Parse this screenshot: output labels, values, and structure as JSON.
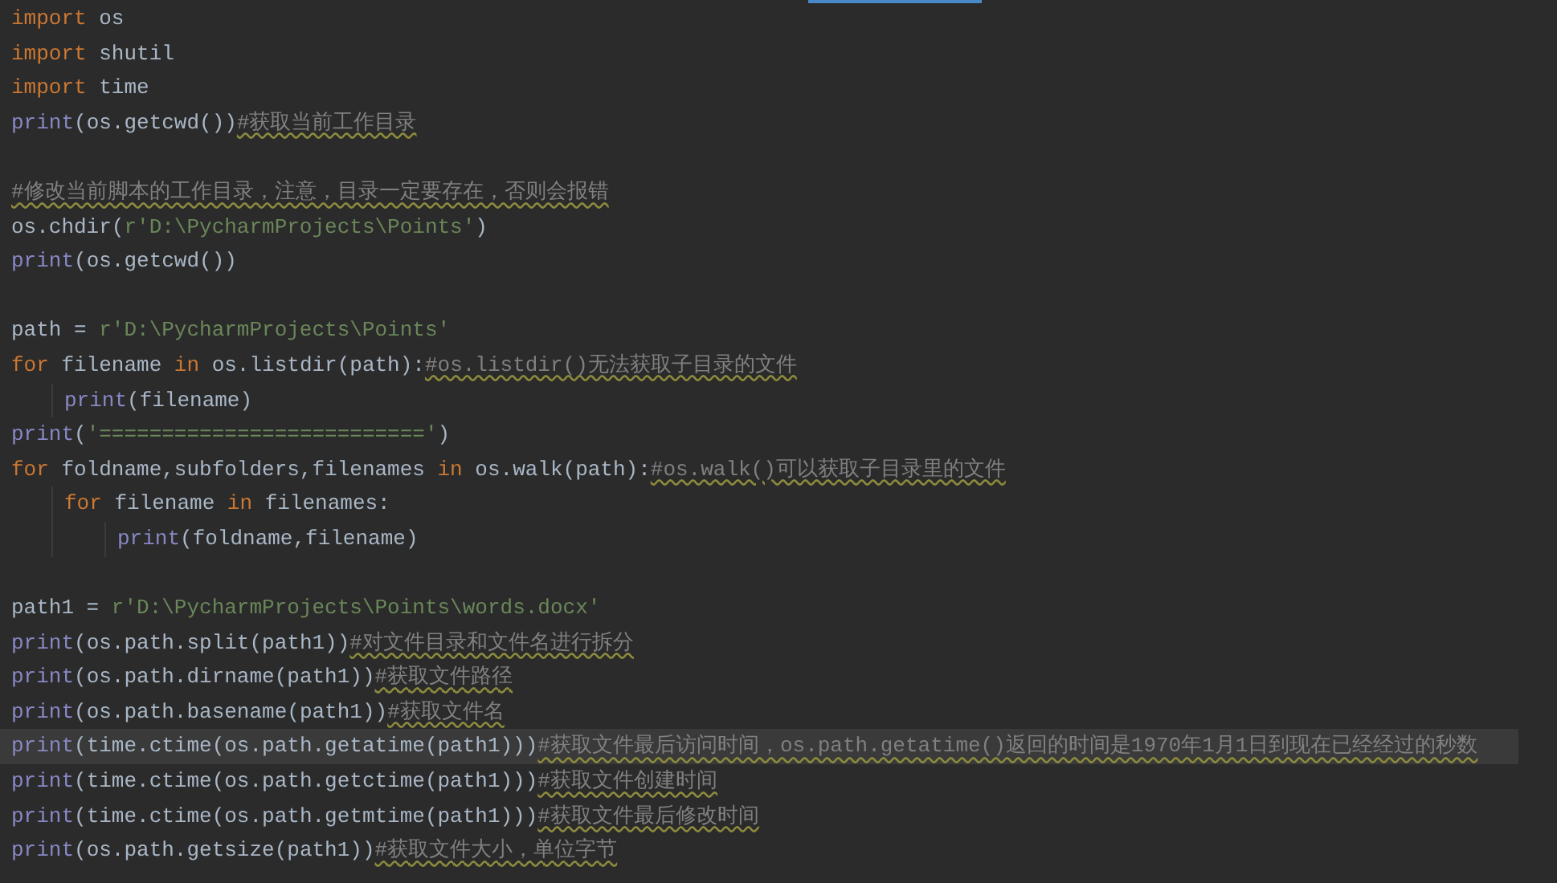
{
  "editor": {
    "lines": [
      {
        "current": false,
        "tokens": [
          {
            "kind": "keyword",
            "text": "import"
          },
          {
            "kind": "plain",
            "text": " os"
          }
        ]
      },
      {
        "current": false,
        "tokens": [
          {
            "kind": "keyword",
            "text": "import"
          },
          {
            "kind": "plain",
            "text": " shutil"
          }
        ]
      },
      {
        "current": false,
        "tokens": [
          {
            "kind": "keyword",
            "text": "import"
          },
          {
            "kind": "plain",
            "text": " time"
          }
        ]
      },
      {
        "current": false,
        "tokens": [
          {
            "kind": "builtin",
            "text": "print"
          },
          {
            "kind": "plain",
            "text": "(os.getcwd())"
          },
          {
            "kind": "comment",
            "text": "#获取当前工作目录"
          }
        ]
      },
      {
        "current": false
      },
      {
        "current": false,
        "tokens": [
          {
            "kind": "comment",
            "text": "#修改当前脚本的工作目录，注意，目录一定要存在，否则会报错"
          }
        ]
      },
      {
        "current": false,
        "tokens": [
          {
            "kind": "plain",
            "text": "os.chdir("
          },
          {
            "kind": "string",
            "text": "r'D:\\PycharmProjects\\Points'"
          },
          {
            "kind": "plain",
            "text": ")"
          }
        ]
      },
      {
        "current": false,
        "tokens": [
          {
            "kind": "builtin",
            "text": "print"
          },
          {
            "kind": "plain",
            "text": "(os.getcwd())"
          }
        ]
      },
      {
        "current": false
      },
      {
        "current": false,
        "tokens": [
          {
            "kind": "plain",
            "text": "path = "
          },
          {
            "kind": "string",
            "text": "r'D:\\PycharmProjects\\Points'"
          }
        ]
      },
      {
        "current": false,
        "tokens": [
          {
            "kind": "keyword",
            "text": "for"
          },
          {
            "kind": "plain",
            "text": " filename "
          },
          {
            "kind": "keyword",
            "text": "in"
          },
          {
            "kind": "plain",
            "text": " os.listdir(path):"
          },
          {
            "kind": "comment",
            "text": "#os.listdir()无法获取子目录的文件"
          }
        ],
        "children": [
          {
            "current": false,
            "tokens": [
              {
                "kind": "builtin",
                "text": "print"
              },
              {
                "kind": "plain",
                "text": "(filename)"
              }
            ]
          }
        ]
      },
      {
        "current": false,
        "tokens": [
          {
            "kind": "builtin",
            "text": "print"
          },
          {
            "kind": "plain",
            "text": "("
          },
          {
            "kind": "string",
            "text": "'=========================='"
          },
          {
            "kind": "plain",
            "text": ")"
          }
        ]
      },
      {
        "current": false,
        "tokens": [
          {
            "kind": "keyword",
            "text": "for"
          },
          {
            "kind": "plain",
            "text": " foldname,subfolders,filenames "
          },
          {
            "kind": "keyword",
            "text": "in"
          },
          {
            "kind": "plain",
            "text": " os.walk(path):"
          },
          {
            "kind": "comment",
            "text": "#os.walk()可以获取子目录里的文件"
          }
        ],
        "children": [
          {
            "current": false,
            "tokens": [
              {
                "kind": "keyword",
                "text": "for"
              },
              {
                "kind": "plain",
                "text": " filename "
              },
              {
                "kind": "keyword",
                "text": "in"
              },
              {
                "kind": "plain",
                "text": " filenames:"
              }
            ],
            "children": [
              {
                "current": false,
                "tokens": [
                  {
                    "kind": "builtin",
                    "text": "print"
                  },
                  {
                    "kind": "plain",
                    "text": "(foldname,filename)"
                  }
                ]
              }
            ]
          }
        ]
      },
      {
        "current": false
      },
      {
        "current": false,
        "tokens": [
          {
            "kind": "plain",
            "text": "path1 = "
          },
          {
            "kind": "string",
            "text": "r'D:\\PycharmProjects\\Points\\words.docx'"
          }
        ]
      },
      {
        "current": false,
        "tokens": [
          {
            "kind": "builtin",
            "text": "print"
          },
          {
            "kind": "plain",
            "text": "(os.path.split(path1))"
          },
          {
            "kind": "comment",
            "text": "#对文件目录和文件名进行拆分"
          }
        ]
      },
      {
        "current": false,
        "tokens": [
          {
            "kind": "builtin",
            "text": "print"
          },
          {
            "kind": "plain",
            "text": "(os.path.dirname(path1))"
          },
          {
            "kind": "comment",
            "text": "#获取文件路径"
          }
        ]
      },
      {
        "current": false,
        "tokens": [
          {
            "kind": "builtin",
            "text": "print"
          },
          {
            "kind": "plain",
            "text": "(os.path.basename(path1))"
          },
          {
            "kind": "comment",
            "text": "#获取文件名"
          }
        ]
      },
      {
        "current": true,
        "tokens": [
          {
            "kind": "builtin",
            "text": "print"
          },
          {
            "kind": "plain",
            "text": "(time.ctime(os.path.getatime(path1)))"
          },
          {
            "kind": "comment",
            "text": "#获取文件最后访问时间，os.path.getatime()返回的时间是1970年1月1日到现在已经经过的秒数"
          }
        ]
      },
      {
        "current": false,
        "tokens": [
          {
            "kind": "builtin",
            "text": "print"
          },
          {
            "kind": "plain",
            "text": "(time.ctime(os.path.getctime(path1)))"
          },
          {
            "kind": "comment",
            "text": "#获取文件创建时间"
          }
        ]
      },
      {
        "current": false,
        "tokens": [
          {
            "kind": "builtin",
            "text": "print"
          },
          {
            "kind": "plain",
            "text": "(time.ctime(os.path.getmtime(path1)))"
          },
          {
            "kind": "comment",
            "text": "#获取文件最后修改时间"
          }
        ]
      },
      {
        "current": false,
        "tokens": [
          {
            "kind": "builtin",
            "text": "print"
          },
          {
            "kind": "plain",
            "text": "(os.path.getsize(path1))"
          },
          {
            "kind": "comment",
            "text": "#获取文件大小，单位字节"
          }
        ]
      }
    ]
  }
}
